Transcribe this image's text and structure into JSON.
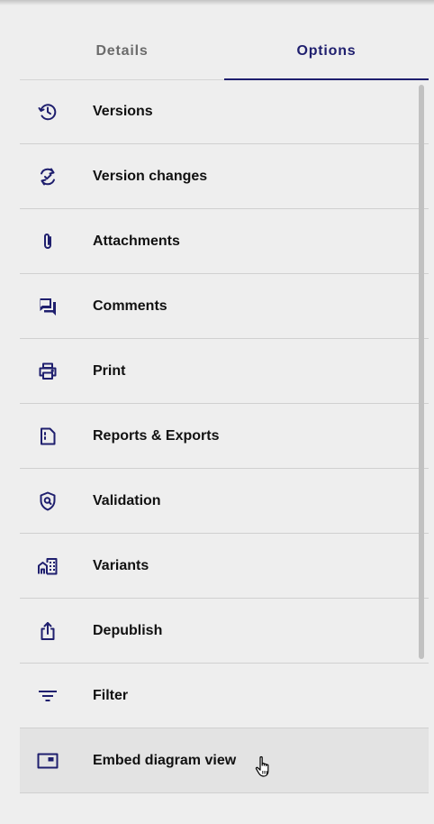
{
  "tabs": [
    {
      "label": "Details",
      "active": false
    },
    {
      "label": "Options",
      "active": true
    }
  ],
  "items": [
    {
      "label": "Versions",
      "icon": "history-icon"
    },
    {
      "label": "Version changes",
      "icon": "sync-check-icon"
    },
    {
      "label": "Attachments",
      "icon": "paperclip-icon"
    },
    {
      "label": "Comments",
      "icon": "forum-icon"
    },
    {
      "label": "Print",
      "icon": "printer-icon"
    },
    {
      "label": "Reports & Exports",
      "icon": "report-icon"
    },
    {
      "label": "Validation",
      "icon": "shield-search-icon"
    },
    {
      "label": "Variants",
      "icon": "buildings-icon"
    },
    {
      "label": "Depublish",
      "icon": "share-upload-icon"
    },
    {
      "label": "Filter",
      "icon": "filter-icon"
    },
    {
      "label": "Embed diagram view",
      "icon": "embed-window-icon",
      "hovered": true
    }
  ],
  "colors": {
    "accent": "#1f1f6e",
    "background": "#eeeeee",
    "divider": "#d0d0d0",
    "hover": "#e3e3e3"
  }
}
